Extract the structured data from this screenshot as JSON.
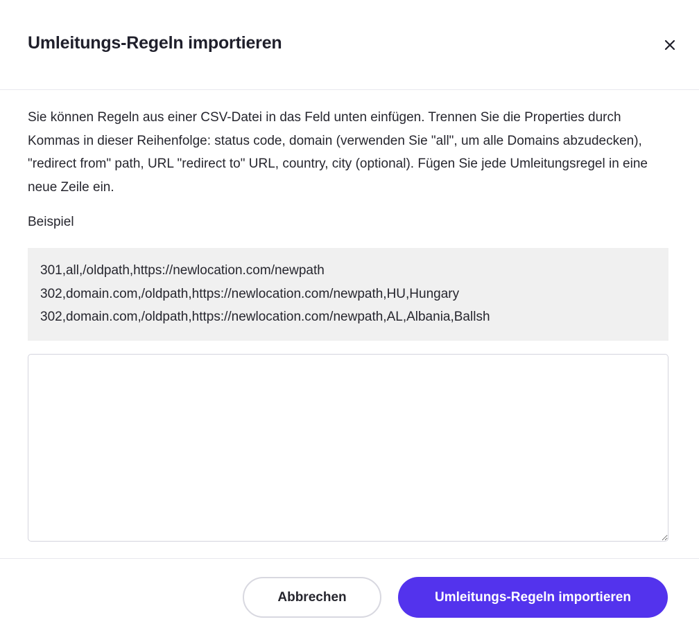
{
  "dialog": {
    "title": "Umleitungs-Regeln importieren",
    "close_icon": "close-icon"
  },
  "body": {
    "description": "Sie können Regeln aus einer CSV-Datei in das Feld unten einfügen. Trennen Sie die Properties durch Kommas in dieser Reihenfolge: status code, domain (verwenden Sie \"all\", um alle Domains abzudecken), \"redirect from\" path, URL \"redirect to\" URL, country, city (optional). Fügen Sie jede Umleitungsregel in eine neue Zeile ein.",
    "example_label": "Beispiel",
    "example_lines": [
      "301,all,/oldpath,https://newlocation.com/newpath",
      "302,domain.com,/oldpath,https://newlocation.com/newpath,HU,Hungary",
      "302,domain.com,/oldpath,https://newlocation.com/newpath,AL,Albania,Ballsh"
    ],
    "textarea": {
      "value": "",
      "placeholder": ""
    }
  },
  "footer": {
    "cancel_label": "Abbrechen",
    "import_label": "Umleitungs-Regeln importieren"
  },
  "colors": {
    "primary": "#5333ed",
    "example_background": "#f0f0f0",
    "text": "#26262e"
  }
}
